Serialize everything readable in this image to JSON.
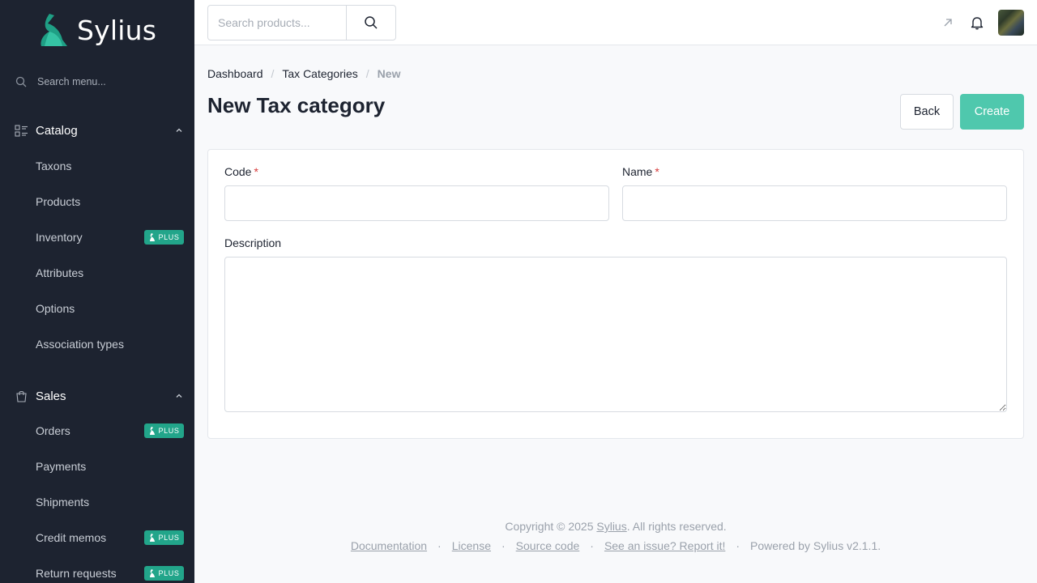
{
  "brand": {
    "name": "Sylius",
    "accent": "#4fc8ad",
    "sidebar_bg": "#1d2330"
  },
  "sidebar": {
    "search_placeholder": "Search menu...",
    "sections": [
      {
        "label": "Catalog",
        "icon": "list-icon",
        "items": [
          {
            "label": "Taxons"
          },
          {
            "label": "Products"
          },
          {
            "label": "Inventory",
            "badge": "PLUS"
          },
          {
            "label": "Attributes"
          },
          {
            "label": "Options"
          },
          {
            "label": "Association types"
          }
        ]
      },
      {
        "label": "Sales",
        "icon": "shopping-bag-icon",
        "items": [
          {
            "label": "Orders",
            "badge": "PLUS"
          },
          {
            "label": "Payments"
          },
          {
            "label": "Shipments"
          },
          {
            "label": "Credit memos",
            "badge": "PLUS"
          },
          {
            "label": "Return requests",
            "badge": "PLUS"
          }
        ]
      }
    ]
  },
  "topbar": {
    "search_placeholder": "Search products...",
    "icons": [
      "search-icon",
      "external-link-icon",
      "bell-icon",
      "avatar"
    ]
  },
  "breadcrumb": {
    "items": [
      "Dashboard",
      "Tax Categories"
    ],
    "current": "New"
  },
  "page": {
    "title": "New Tax category",
    "back_label": "Back",
    "create_label": "Create"
  },
  "form": {
    "code_label": "Code",
    "code_value": "",
    "name_label": "Name",
    "name_value": "",
    "required_marker": "*",
    "description_label": "Description",
    "description_value": ""
  },
  "footer": {
    "copyright_prefix": "Copyright © 2025",
    "copyright_link": "Sylius",
    "copyright_suffix": ". All rights reserved.",
    "links": [
      "Documentation",
      "License",
      "Source code",
      "See an issue? Report it!"
    ],
    "separator": "·",
    "powered": "Powered by Sylius v2.1.1."
  }
}
